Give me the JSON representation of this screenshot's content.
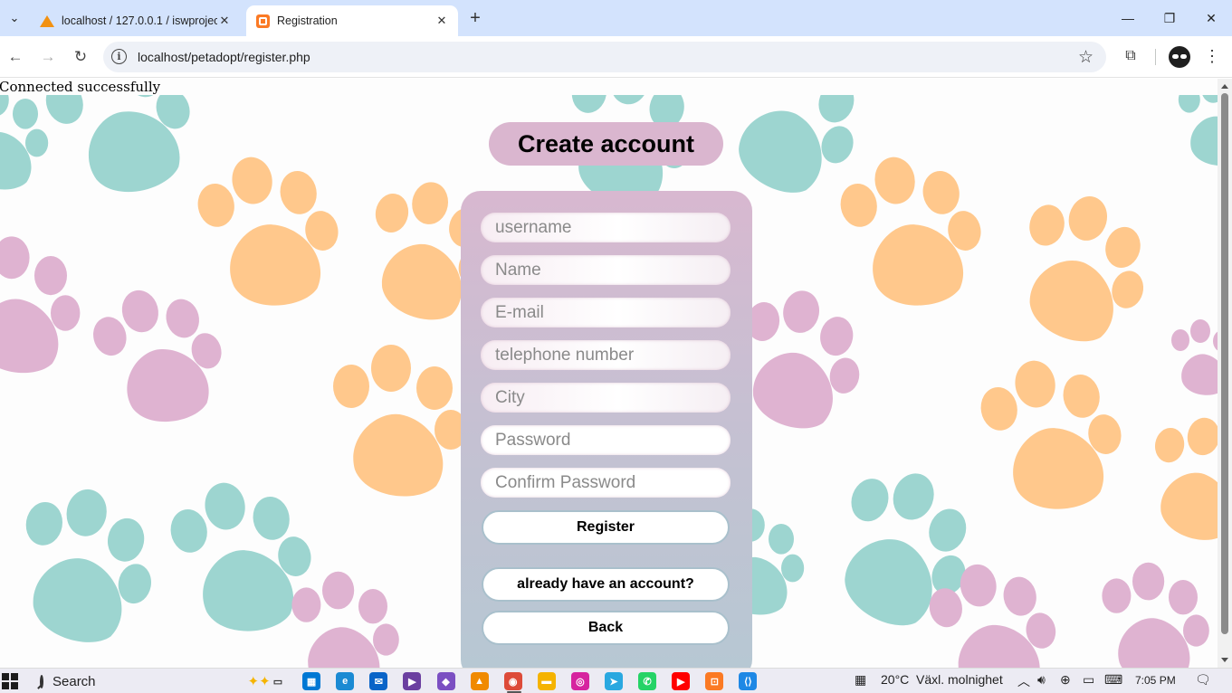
{
  "browser": {
    "tabs": [
      {
        "title": "localhost / 127.0.0.1 / iswprojec",
        "favicon": "phpmyadmin-icon"
      },
      {
        "title": "Registration",
        "favicon": "xampp-icon",
        "active": true
      }
    ],
    "address_bar": {
      "url": "localhost/petadopt/register.php"
    },
    "icons": {
      "back": "arrow-left-icon",
      "forward": "arrow-right-icon",
      "reload": "reload-icon",
      "site_info": "info-icon",
      "bookmark": "star-icon",
      "extensions": "puzzle-icon",
      "profile": "avatar-icon",
      "menu": "kebab-menu-icon"
    }
  },
  "page": {
    "status_message": "Connected successfully",
    "heading": "Create account",
    "form": {
      "fields": [
        {
          "name": "username",
          "placeholder": "username",
          "value": ""
        },
        {
          "name": "name",
          "placeholder": "Name",
          "value": ""
        },
        {
          "name": "email",
          "placeholder": "E-mail",
          "value": ""
        },
        {
          "name": "telephone",
          "placeholder": "telephone number",
          "value": ""
        },
        {
          "name": "city",
          "placeholder": "City",
          "value": ""
        },
        {
          "name": "password",
          "placeholder": "Password",
          "value": ""
        },
        {
          "name": "confirm_password",
          "placeholder": "Confirm Password",
          "value": ""
        }
      ],
      "register_label": "Register",
      "login_link_label": "already have an account?",
      "back_label": "Back"
    },
    "background": {
      "pattern": "paw-prints",
      "colors": {
        "teal": "#9dd5d0",
        "orange": "#ffc88c",
        "pink": "#dfb3d1"
      }
    },
    "card_colors": {
      "top": "#d8b8d0",
      "bottom": "#b6c8d3"
    }
  },
  "taskbar": {
    "search_label": "Search",
    "weather_temp": "20°C",
    "weather_desc": "Växl. molnighet",
    "time": "7:05 PM",
    "apps": [
      "task-view-icon",
      "store-icon",
      "edge-icon",
      "mail-icon",
      "media-player-icon",
      "visual-studio-icon",
      "vlc-icon",
      "chrome-icon",
      "file-explorer-icon",
      "instagram-icon",
      "telegram-icon",
      "whatsapp-icon",
      "youtube-icon",
      "xampp-icon",
      "vscode-icon"
    ]
  }
}
